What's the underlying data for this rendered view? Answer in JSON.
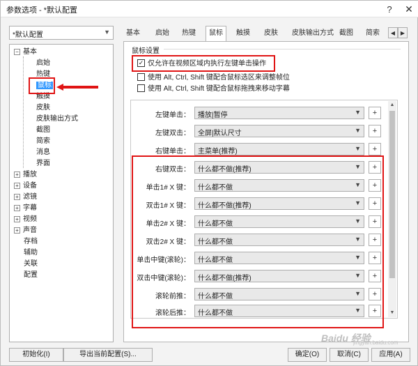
{
  "window": {
    "title": "参数选项 - *默认配置",
    "help_label": "?",
    "close_label": "✕"
  },
  "profile": {
    "value": "*默认配置"
  },
  "tabs": [
    "基本",
    "启始",
    "热键",
    "鼠标",
    "触摸",
    "皮肤",
    "皮肤输出方式",
    "截图",
    "简索"
  ],
  "active_tab": "鼠标",
  "tree": [
    {
      "label": "基本",
      "expander": "−"
    },
    {
      "label": "启始"
    },
    {
      "label": "热键"
    },
    {
      "label": "鼠标",
      "selected": true
    },
    {
      "label": "触摸"
    },
    {
      "label": "皮肤"
    },
    {
      "label": "皮肤输出方式"
    },
    {
      "label": "截图"
    },
    {
      "label": "简索"
    },
    {
      "label": "消息"
    },
    {
      "label": "界面"
    },
    {
      "label": "播放",
      "expander": "+"
    },
    {
      "label": "设备",
      "expander": "+"
    },
    {
      "label": "滤镜",
      "expander": "+"
    },
    {
      "label": "字幕",
      "expander": "+"
    },
    {
      "label": "视频",
      "expander": "+"
    },
    {
      "label": "声音",
      "expander": "+"
    },
    {
      "label": "存档"
    },
    {
      "label": "辅助"
    },
    {
      "label": "关联"
    },
    {
      "label": "配置"
    }
  ],
  "mouse_settings": {
    "group_label": "鼠标设置",
    "checkboxes": [
      {
        "label": "仅允许在视频区域内执行左键单击操作",
        "checked": true
      },
      {
        "label": "使用 Alt, Ctrl, Shift 键配合鼠标选区来调整帧位",
        "checked": false
      },
      {
        "label": "使用 Alt, Ctrl, Shift 键配合鼠标拖拽来移动字幕",
        "checked": false
      }
    ],
    "rows": [
      {
        "label": "左键单击：",
        "value": "播放|暂停"
      },
      {
        "label": "左键双击：",
        "value": "全屏|默认尺寸"
      },
      {
        "label": "右键单击：",
        "value": "主菜单(推荐)"
      },
      {
        "label": "右键双击：",
        "value": "什么都不做(推荐)"
      },
      {
        "label": "单击1# X 键：",
        "value": "什么都不做"
      },
      {
        "label": "双击1# X 键：",
        "value": "什么都不做(推荐)"
      },
      {
        "label": "单击2# X 键：",
        "value": "什么都不做"
      },
      {
        "label": "双击2# X 键：",
        "value": "什么都不做"
      },
      {
        "label": "单击中键(滚轮)：",
        "value": "什么都不做"
      },
      {
        "label": "双击中键(滚轮)：",
        "value": "什么都不做(推荐)"
      },
      {
        "label": "滚轮前推：",
        "value": "什么都不做"
      },
      {
        "label": "滚轮后推：",
        "value": "什么都不做"
      }
    ],
    "plus_label": "+"
  },
  "buttons": {
    "init": "初始化(I)",
    "export": "导出当前配置(S)...",
    "ok": "确定(O)",
    "cancel": "取消(C)",
    "apply": "应用(A)"
  },
  "watermark": {
    "text": "Baidu 经验",
    "sub": "jingyan.baidu.com"
  },
  "colors": {
    "annotation": "#e01414",
    "selection": "#3399ff"
  }
}
